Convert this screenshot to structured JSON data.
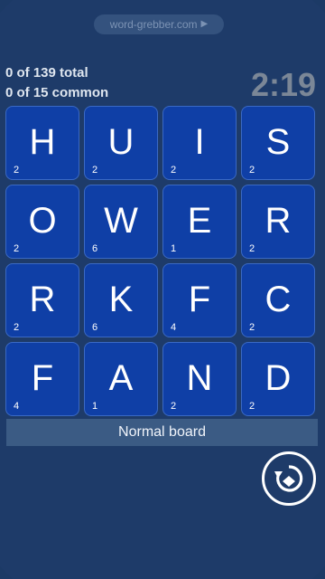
{
  "header": {
    "site": "word-grebber.com",
    "site_arrow_icon": "play-arrow-icon"
  },
  "stats": {
    "total": "0 of 139 total",
    "common": "0 of 15 common"
  },
  "timer": "2:19",
  "tiles": [
    {
      "letter": "H",
      "points": "2"
    },
    {
      "letter": "U",
      "points": "2"
    },
    {
      "letter": "I",
      "points": "2"
    },
    {
      "letter": "S",
      "points": "2"
    },
    {
      "letter": "O",
      "points": "2"
    },
    {
      "letter": "W",
      "points": "6"
    },
    {
      "letter": "E",
      "points": "1"
    },
    {
      "letter": "R",
      "points": "2"
    },
    {
      "letter": "R",
      "points": "2"
    },
    {
      "letter": "K",
      "points": "6"
    },
    {
      "letter": "F",
      "points": "4"
    },
    {
      "letter": "C",
      "points": "2"
    },
    {
      "letter": "F",
      "points": "4"
    },
    {
      "letter": "A",
      "points": "1"
    },
    {
      "letter": "N",
      "points": "2"
    },
    {
      "letter": "D",
      "points": "2"
    }
  ],
  "board_label": "Normal board",
  "rotate_icon": "rotate-board-icon",
  "colors": {
    "background": "#1e3b69",
    "tile": "#0f3fa6",
    "tile_border": "#3a69c4",
    "label_bar": "#3b5b84"
  }
}
